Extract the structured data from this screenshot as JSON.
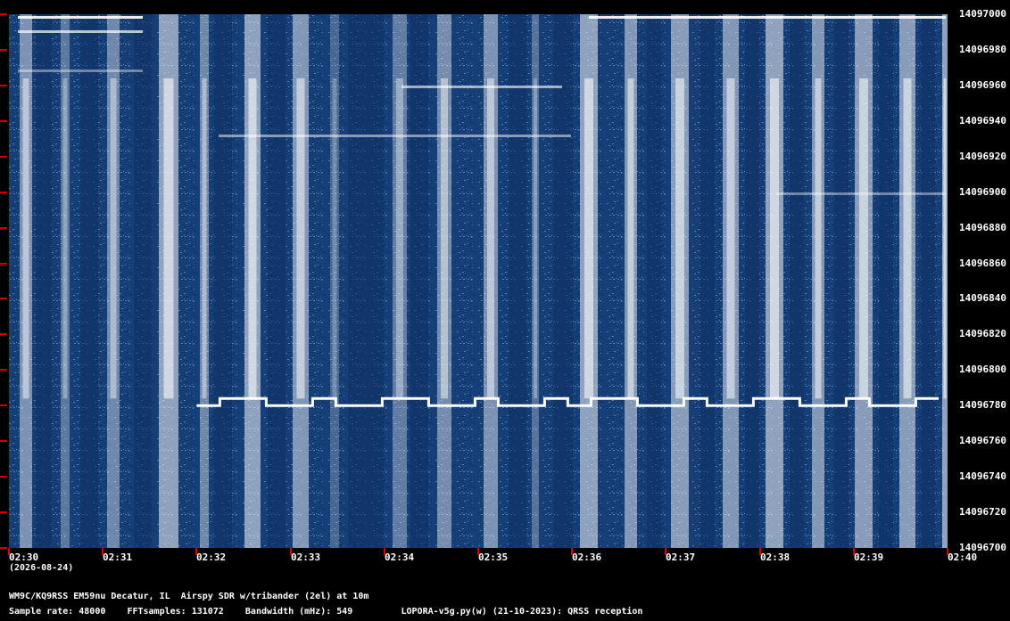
{
  "chart_data": {
    "type": "heatmap",
    "title": "",
    "xlabel": "",
    "ylabel": "",
    "x_ticks": [
      "02:30",
      "02:31",
      "02:32",
      "02:33",
      "02:34",
      "02:35",
      "02:36",
      "02:37",
      "02:38",
      "02:39",
      "02:40"
    ],
    "y_ticks": [
      "14097000",
      "14096980",
      "14096960",
      "14096940",
      "14096920",
      "14096900",
      "14096880",
      "14096860",
      "14096840",
      "14096820",
      "14096800",
      "14096780",
      "14096760",
      "14096740",
      "14096720",
      "14096700"
    ],
    "ylim": [
      14096700,
      14097000
    ],
    "xlim": [
      "02:30",
      "02:40"
    ],
    "grid": false,
    "colors": {
      "background": "#163f78",
      "signal": "#ffffff",
      "tick": "#d00000"
    },
    "signal_trace": {
      "name": "",
      "frequency_hz": 14096780,
      "start": "02:32",
      "end": "02:40"
    }
  },
  "header": {
    "date": "(2026-08-24)"
  },
  "info": {
    "line1": "WM9C/KQ9RSS EM59nu Decatur, IL  Airspy SDR w/tribander (2el) at 10m",
    "line2": "Sample rate: 48000    FFTsamples: 131072    Bandwidth (mHz): 549         LOPORA-v5g.py(w) (21-10-2023): QRSS reception"
  }
}
